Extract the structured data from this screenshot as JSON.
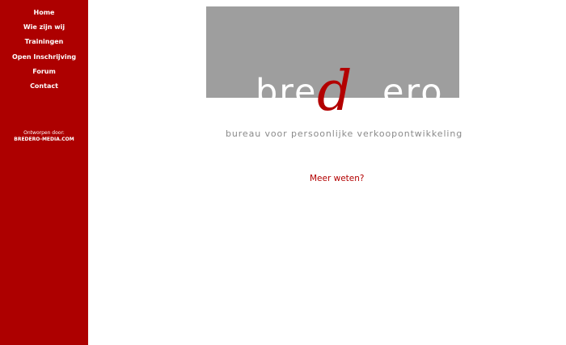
{
  "colors": {
    "sidebar": "#ad0000",
    "logo_gray": "#9e9e9e",
    "accent": "#b30000",
    "tagline": "#8a8a8a"
  },
  "nav": {
    "items": [
      {
        "label": "Home"
      },
      {
        "label": "Wie zijn wij"
      },
      {
        "label": "Trainingen"
      },
      {
        "label": "Open Inschrijving"
      },
      {
        "label": "Forum"
      },
      {
        "label": "Contact"
      }
    ]
  },
  "credit": {
    "line1": "Ontworpen door:",
    "line2": "BREDERO-MEDIA.COM"
  },
  "logo": {
    "text_before": "bre",
    "accent_letter": "d",
    "text_after": "ero",
    "tagline": "bureau voor persoonlijke verkoopontwikkeling"
  },
  "main": {
    "more_link": "Meer weten?"
  }
}
